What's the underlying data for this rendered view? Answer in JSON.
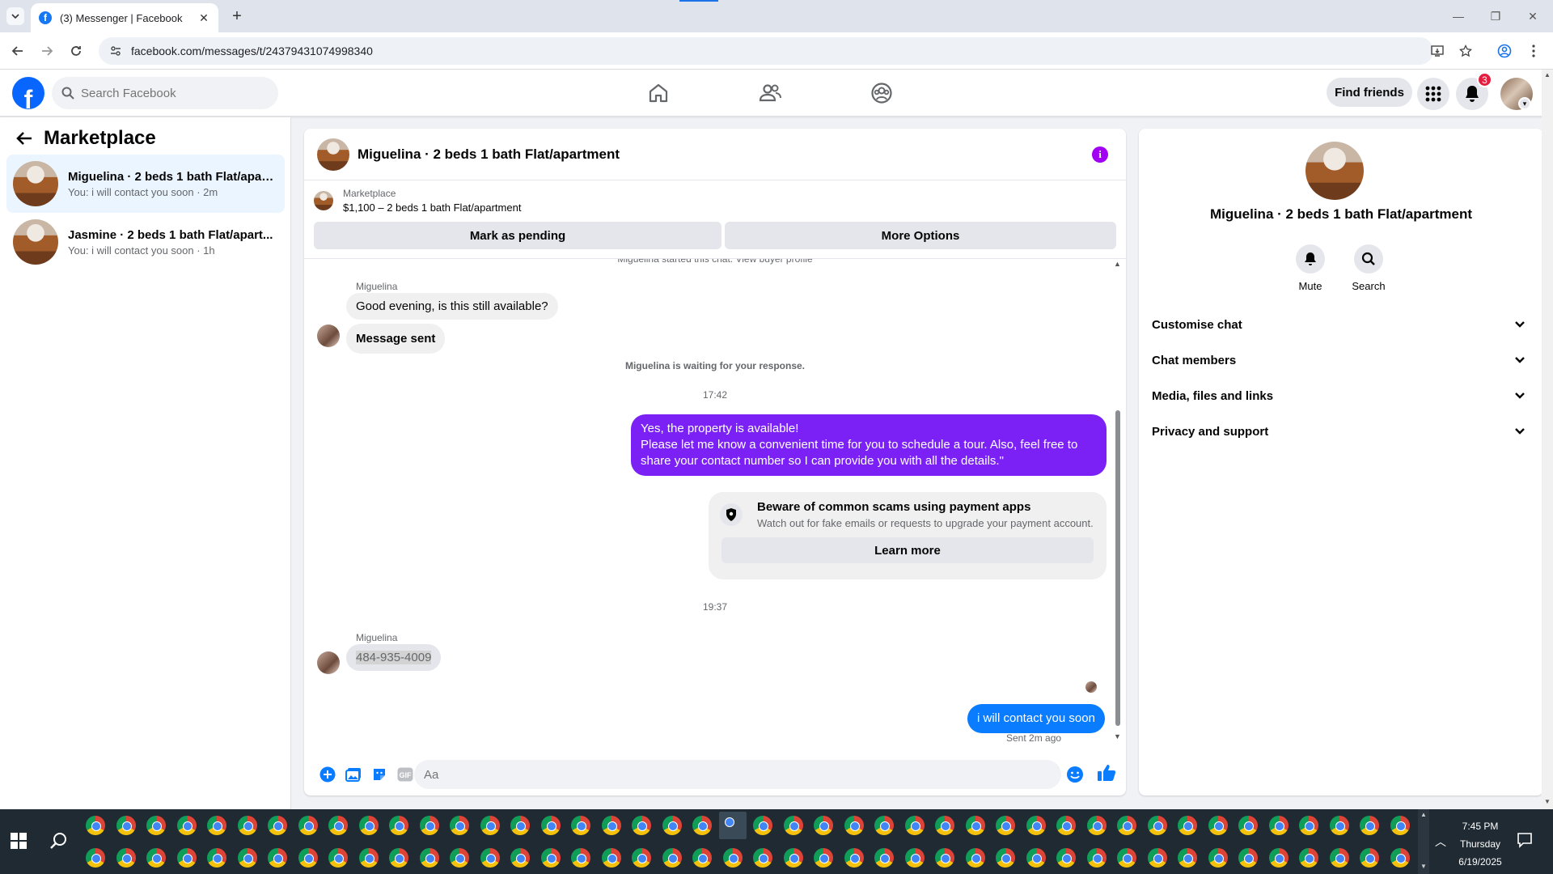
{
  "browser": {
    "tab_title": "(3) Messenger | Facebook",
    "url": "facebook.com/messages/t/24379431074998340"
  },
  "fb": {
    "search_placeholder": "Search Facebook",
    "find_friends": "Find friends",
    "notification_count": "3",
    "brand_color": "#0866ff"
  },
  "sidebar": {
    "title": "Marketplace",
    "conversations": [
      {
        "name": "Miguelina · 2 beds 1 bath Flat/apart...",
        "snippet": "You: i will contact you soon · 2m"
      },
      {
        "name": "Jasmine · 2 beds 1 bath Flat/apart...",
        "snippet": "You: i will contact you soon · 1h"
      }
    ]
  },
  "chat": {
    "title": "Miguelina · 2 beds 1 bath Flat/apartment",
    "listing_source": "Marketplace",
    "listing_price": "$1,100 – 2 beds 1 bath Flat/apartment",
    "mark_pending": "Mark as pending",
    "more_options": "More Options",
    "partial_sys": "Miguelina started this chat. View buyer profile",
    "msg1_sender": "Miguelina",
    "msg1": "Good evening, is this still available?",
    "msg2": "Message sent",
    "waiting": "Miguelina is waiting for your response.",
    "time1": "17:42",
    "out1_line1": "Yes, the property is available!",
    "out1_line2": "Please let me know a convenient time for you to schedule a tour. Also, feel free to share your contact number so I can provide you with all the details.\"",
    "scam_title": "Beware of common scams using payment apps",
    "scam_sub": "Watch out for fake emails or requests to upgrade your payment account.",
    "learn_more": "Learn more",
    "time2": "19:37",
    "msg3_sender": "Miguelina",
    "msg3": "484-935-4009",
    "out2": "i will contact you soon",
    "out2_status": "Sent 2m ago",
    "composer_placeholder": "Aa",
    "out_color_purple": "#7b21f5",
    "out_color_blue": "#0a7cff"
  },
  "details": {
    "name": "Miguelina · 2 beds 1 bath Flat/apartment",
    "mute": "Mute",
    "search": "Search",
    "sections": [
      "Customise chat",
      "Chat members",
      "Media, files and links",
      "Privacy and support"
    ]
  },
  "taskbar": {
    "time": "7:45 PM",
    "day": "Thursday",
    "date": "6/19/2025"
  }
}
